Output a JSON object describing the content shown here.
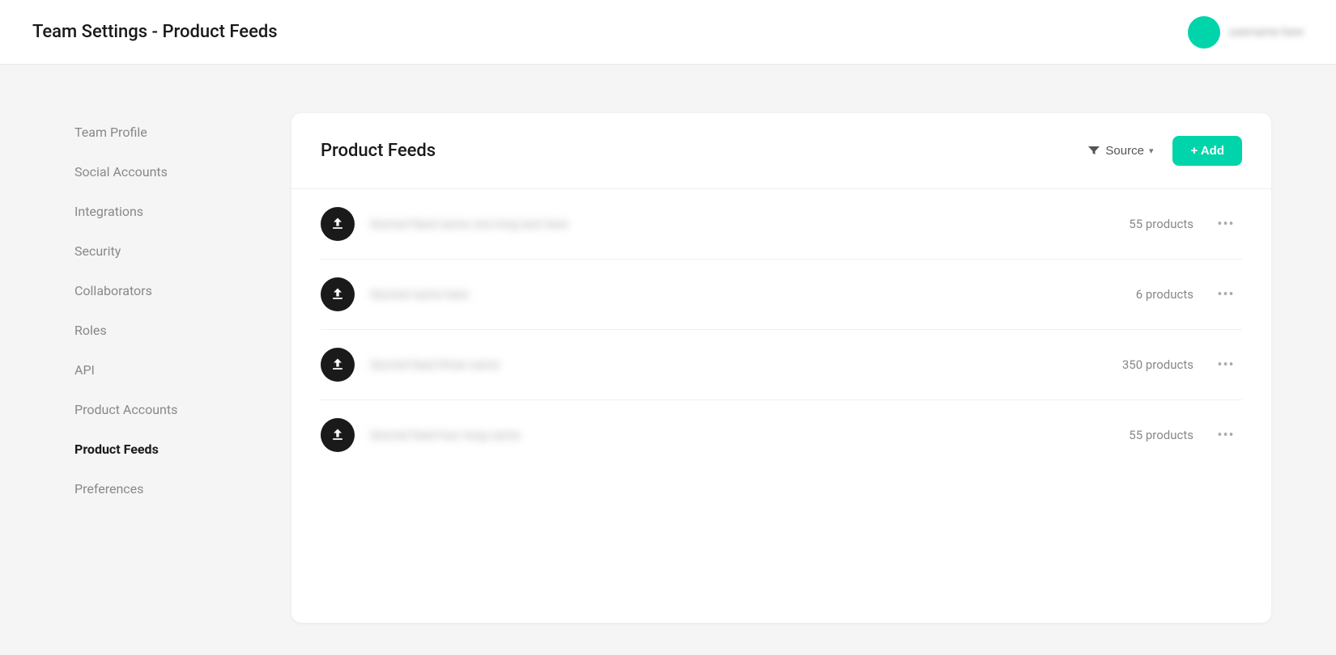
{
  "header": {
    "title": "Team Settings - Product Feeds",
    "avatar_name": "username here"
  },
  "sidebar": {
    "items": [
      {
        "id": "team-profile",
        "label": "Team Profile",
        "active": false
      },
      {
        "id": "social-accounts",
        "label": "Social Accounts",
        "active": false
      },
      {
        "id": "integrations",
        "label": "Integrations",
        "active": false
      },
      {
        "id": "security",
        "label": "Security",
        "active": false
      },
      {
        "id": "collaborators",
        "label": "Collaborators",
        "active": false
      },
      {
        "id": "roles",
        "label": "Roles",
        "active": false
      },
      {
        "id": "api",
        "label": "API",
        "active": false
      },
      {
        "id": "product-accounts",
        "label": "Product Accounts",
        "active": false
      },
      {
        "id": "product-feeds",
        "label": "Product Feeds",
        "active": true
      },
      {
        "id": "preferences",
        "label": "Preferences",
        "active": false
      }
    ]
  },
  "panel": {
    "title": "Product Feeds",
    "filter_label": "Source",
    "add_label": "+ Add",
    "feeds": [
      {
        "id": 1,
        "name": "blurred feed name one",
        "count": "55 products"
      },
      {
        "id": 2,
        "name": "blurred name",
        "count": "6 products"
      },
      {
        "id": 3,
        "name": "blurred feed name three",
        "count": "350 products"
      },
      {
        "id": 4,
        "name": "blurred feed name four",
        "count": "55 products"
      }
    ],
    "menu_dots": "•••"
  },
  "colors": {
    "accent": "#00d4aa"
  }
}
